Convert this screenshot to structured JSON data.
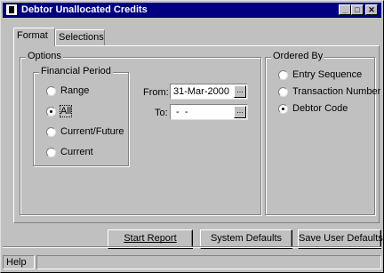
{
  "window": {
    "title": "Debtor Unallocated Credits",
    "minimize": "_",
    "maximize": "□",
    "close": "✕"
  },
  "tabs": [
    {
      "label": "Format"
    },
    {
      "label": "Selections"
    }
  ],
  "options": {
    "legend": "Options",
    "financial_period": {
      "legend": "Financial Period",
      "items": [
        {
          "label": "Range",
          "selected": false
        },
        {
          "label": "All",
          "selected": true
        },
        {
          "label": "Current/Future",
          "selected": false
        },
        {
          "label": "Current",
          "selected": false
        }
      ]
    },
    "from_label": "From:",
    "from_value": "31-Mar-2000",
    "to_label": "To:",
    "to_value": " -  -",
    "ellipsis": "..."
  },
  "ordered_by": {
    "legend": "Ordered By",
    "items": [
      {
        "label": "Entry Sequence",
        "selected": false
      },
      {
        "label": "Transaction Number",
        "selected": false
      },
      {
        "label": "Debtor Code",
        "selected": true
      }
    ]
  },
  "buttons": {
    "start_report": "Start Report",
    "system_defaults": "System Defaults",
    "save_user_defaults": "Save User Defaults"
  },
  "status": {
    "help": "Help",
    "message": ""
  }
}
